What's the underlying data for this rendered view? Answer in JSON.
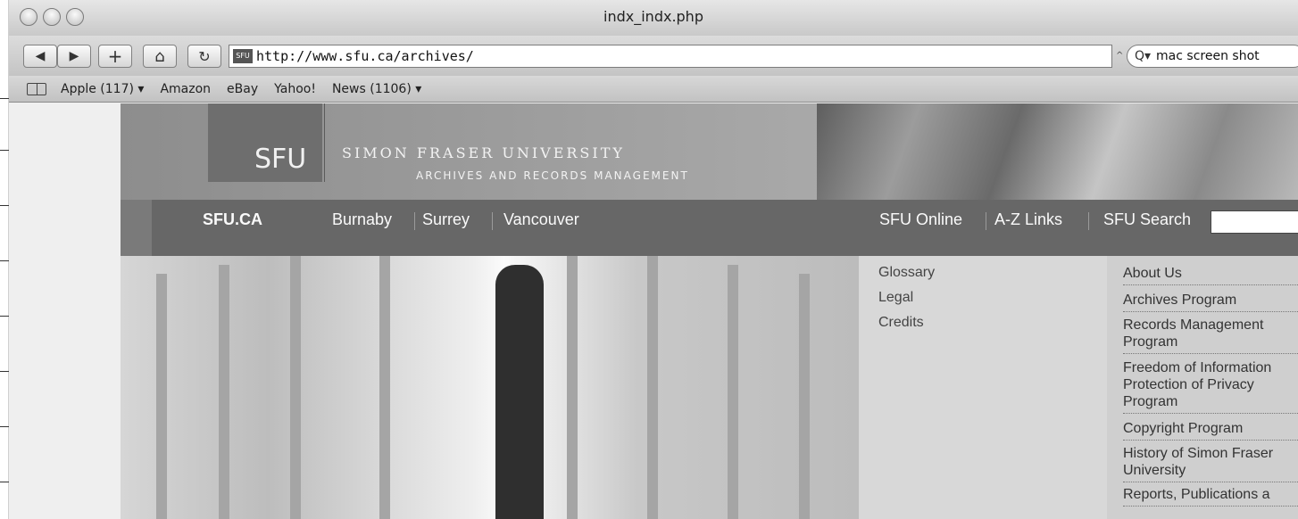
{
  "window": {
    "title": "indx_indx.php"
  },
  "toolbar": {
    "back_icon": "◀",
    "forward_icon": "▶",
    "add_icon": "+",
    "home_icon": "⌂",
    "reload_icon": "↻",
    "favicon_text": "SFU",
    "url": "http://www.sfu.ca/archives/",
    "search_glyph": "Q▾",
    "search_value": "mac screen shot",
    "search_caret": "^"
  },
  "bookmarks": {
    "items": [
      "Apple (117) ▾",
      "Amazon",
      "eBay",
      "Yahoo!",
      "News (1106) ▾"
    ]
  },
  "header": {
    "logo": "SFU",
    "university": "SIMON FRASER UNIVERSITY",
    "department": "ARCHIVES AND RECORDS MANAGEMENT"
  },
  "nav": {
    "home": "SFU.CA",
    "campuses": [
      "Burnaby",
      "Surrey",
      "Vancouver"
    ],
    "online": "SFU Online",
    "az": "A-Z Links",
    "search": "SFU Search"
  },
  "links_mid": [
    "Glossary",
    "Legal",
    "Credits"
  ],
  "links_right": [
    "About Us",
    "Archives Program",
    "Records Management Program",
    "Freedom of Information Protection of Privacy Program",
    "Copyright Program",
    "History of Simon Fraser University",
    "Reports, Publications a"
  ]
}
